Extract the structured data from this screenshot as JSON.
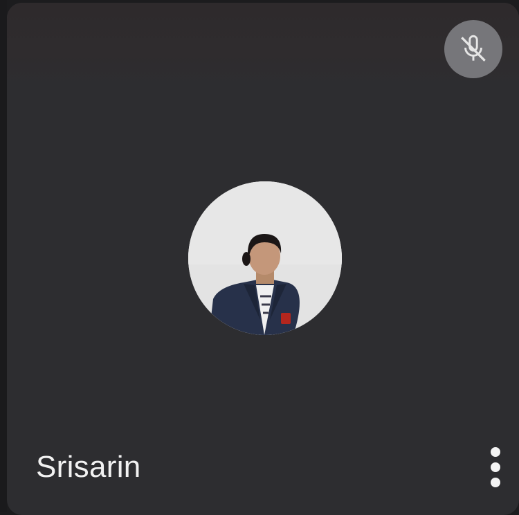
{
  "participant": {
    "name": "Srisarin",
    "avatar_icon": "profile-photo",
    "mic_status_icon": "mic-off-icon",
    "more_options_icon": "more-vert-icon"
  },
  "colors": {
    "tile_background": "#2d2d30",
    "mute_badge": "#76767a",
    "text": "#f2f2f2"
  }
}
